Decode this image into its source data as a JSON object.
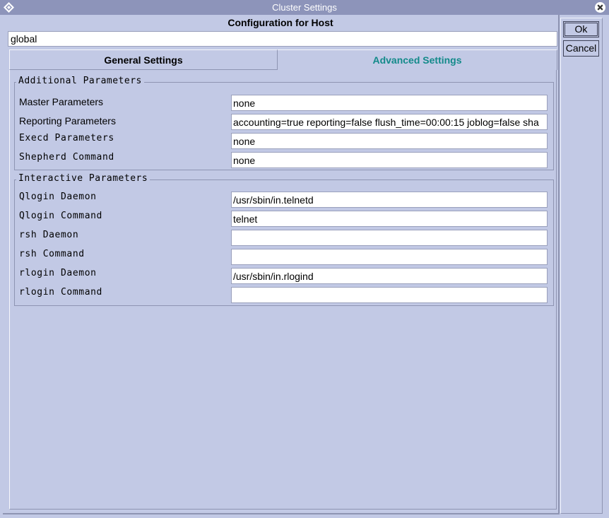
{
  "window": {
    "title": "Cluster Settings"
  },
  "header": {
    "title": "Configuration for Host",
    "host": "global"
  },
  "tabs": {
    "general": "General Settings",
    "advanced": "Advanced Settings"
  },
  "additional": {
    "title": "Additional Parameters",
    "rows": [
      {
        "label": "Master Parameters",
        "value": "none"
      },
      {
        "label": "Reporting Parameters",
        "value": "accounting=true reporting=false flush_time=00:00:15 joblog=false sha"
      },
      {
        "label": "Execd Parameters",
        "value": "none"
      },
      {
        "label": "Shepherd Command",
        "value": "none"
      }
    ]
  },
  "interactive": {
    "title": "Interactive Parameters",
    "rows": [
      {
        "label": "Qlogin Daemon",
        "value": "/usr/sbin/in.telnetd"
      },
      {
        "label": "Qlogin Command",
        "value": "telnet"
      },
      {
        "label": "rsh Daemon",
        "value": ""
      },
      {
        "label": "rsh Command",
        "value": ""
      },
      {
        "label": "rlogin Daemon",
        "value": "/usr/sbin/in.rlogind"
      },
      {
        "label": "rlogin Command",
        "value": ""
      }
    ]
  },
  "buttons": {
    "ok": "Ok",
    "cancel": "Cancel"
  },
  "icons": {
    "window": "diamond-logo-icon",
    "close": "close-icon"
  },
  "colors": {
    "background": "#c2c9e5",
    "titlebar": "#8d94ba",
    "active_tab": "#138a8a"
  }
}
